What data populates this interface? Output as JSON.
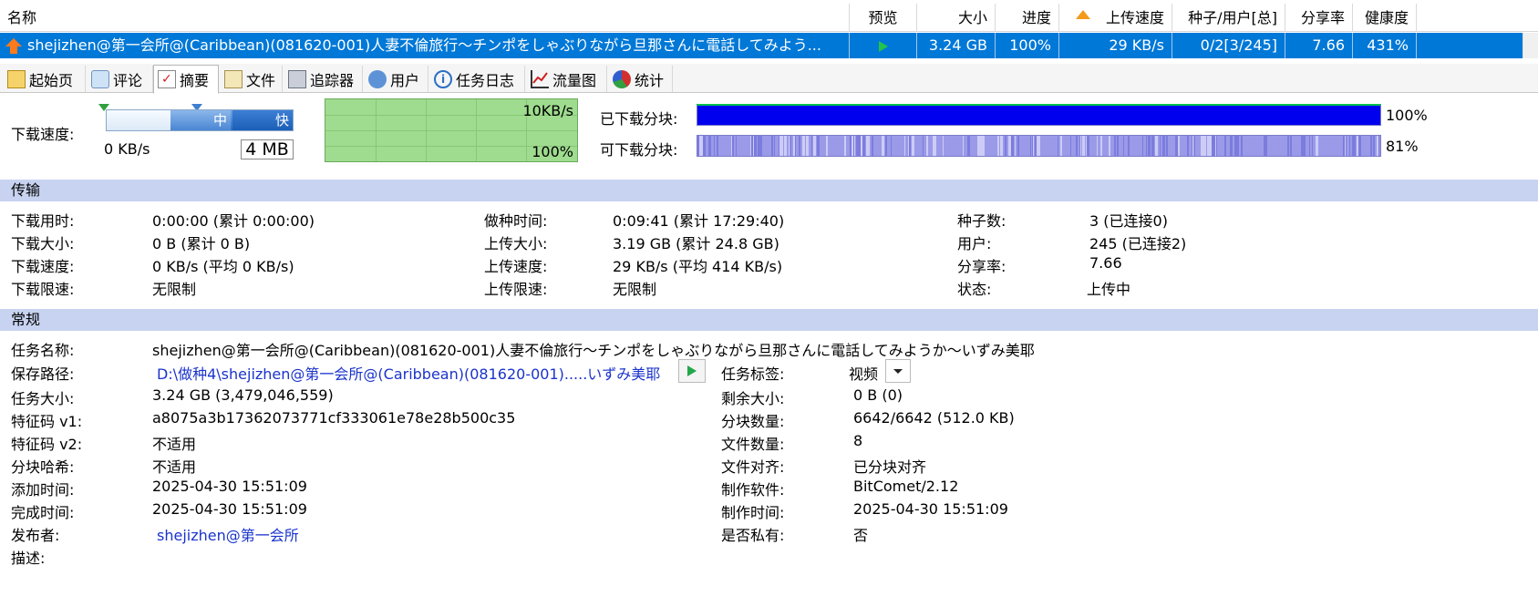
{
  "task_table": {
    "columns": [
      "名称",
      "预览",
      "大小",
      "进度",
      "上传速度",
      "种子/用户[总]",
      "分享率",
      "健康度"
    ],
    "row": {
      "name": "shejizhen@第一会所@(Caribbean)(081620-001)人妻不倫旅行～チンポをしゃぶりながら旦那さんに電話してみよう...",
      "size": "3.24 GB",
      "progress": "100%",
      "upload_speed": "29 KB/s",
      "seeds_peers": "0/2[3/245]",
      "share_ratio": "7.66",
      "health": "431%"
    }
  },
  "tabs": [
    {
      "label": "起始页",
      "icon": "home-page-icon"
    },
    {
      "label": "评论",
      "icon": "comments-icon"
    },
    {
      "label": "摘要",
      "icon": "summary-icon"
    },
    {
      "label": "文件",
      "icon": "files-icon"
    },
    {
      "label": "追踪器",
      "icon": "tracker-icon"
    },
    {
      "label": "用户",
      "icon": "peers-icon"
    },
    {
      "label": "任务日志",
      "icon": "info-icon"
    },
    {
      "label": "流量图",
      "icon": "chart-icon"
    },
    {
      "label": "统计",
      "icon": "stats-icon"
    }
  ],
  "active_tab": "摘要",
  "speed_panel": {
    "label": "下载速度:",
    "current": "0 KB/s",
    "slider_mid": "中",
    "slider_fast": "快",
    "limit_value": "4 MB",
    "graph_top_label": "10KB/s",
    "graph_bottom_label": "100%"
  },
  "pieces": {
    "done_label": "已下载分块:",
    "done_pct": "100%",
    "done_fraction": 1.0,
    "avail_label": "可下载分块:",
    "avail_pct": "81%",
    "avail_fraction": 0.81
  },
  "transfer": {
    "title": "传输",
    "col1": [
      {
        "k": "下载用时:",
        "v": "0:00:00 (累计 0:00:00)"
      },
      {
        "k": "下载大小:",
        "v": "0 B (累计 0 B)"
      },
      {
        "k": "下载速度:",
        "v": "0 KB/s (平均 0 KB/s)"
      },
      {
        "k": "下载限速:",
        "v": "无限制"
      }
    ],
    "col2": [
      {
        "k": "做种时间:",
        "v": "0:09:41 (累计 17:29:40)"
      },
      {
        "k": "上传大小:",
        "v": "3.19 GB (累计 24.8 GB)"
      },
      {
        "k": "上传速度:",
        "v": "29 KB/s (平均 414 KB/s)"
      },
      {
        "k": "上传限速:",
        "v": "无限制"
      }
    ],
    "col3": [
      {
        "k": "种子数:",
        "v": "3 (已连接0)"
      },
      {
        "k": "用户:",
        "v": "245 (已连接2)"
      },
      {
        "k": "分享率:",
        "v": "7.66"
      },
      {
        "k": "状态:",
        "v": "上传中"
      }
    ]
  },
  "general": {
    "title": "常规",
    "task_name_k": "任务名称:",
    "task_name_v": "shejizhen@第一会所@(Caribbean)(081620-001)人妻不倫旅行～チンポをしゃぶりながら旦那さんに電話してみようか～いずみ美耶",
    "save_path_k": "保存路径:",
    "save_path_v": "D:\\做种4\\shejizhen@第一会所@(Caribbean)(081620-001).....いずみ美耶",
    "tag_k": "任务标签:",
    "tag_v": "视频",
    "left": [
      {
        "k": "任务大小:",
        "v": "3.24 GB (3,479,046,559)"
      },
      {
        "k": "特征码 v1:",
        "v": "a8075a3b17362073771cf333061e78e28b500c35"
      },
      {
        "k": "特征码 v2:",
        "v": "不适用"
      },
      {
        "k": "分块哈希:",
        "v": "不适用"
      },
      {
        "k": "添加时间:",
        "v": "2025-04-30 15:51:09"
      },
      {
        "k": "完成时间:",
        "v": "2025-04-30 15:51:09"
      }
    ],
    "right": [
      {
        "k": "剩余大小:",
        "v": "0 B (0)"
      },
      {
        "k": "分块数量:",
        "v": "6642/6642 (512.0 KB)"
      },
      {
        "k": "文件数量:",
        "v": "8"
      },
      {
        "k": "文件对齐:",
        "v": "已分块对齐"
      },
      {
        "k": "制作软件:",
        "v": "BitComet/2.12"
      },
      {
        "k": "制作时间:",
        "v": "2025-04-30 15:51:09"
      },
      {
        "k": "是否私有:",
        "v": "否"
      }
    ],
    "publisher_k": "发布者:",
    "publisher_v": "shejizhen@第一会所",
    "desc_k": "描述:"
  }
}
